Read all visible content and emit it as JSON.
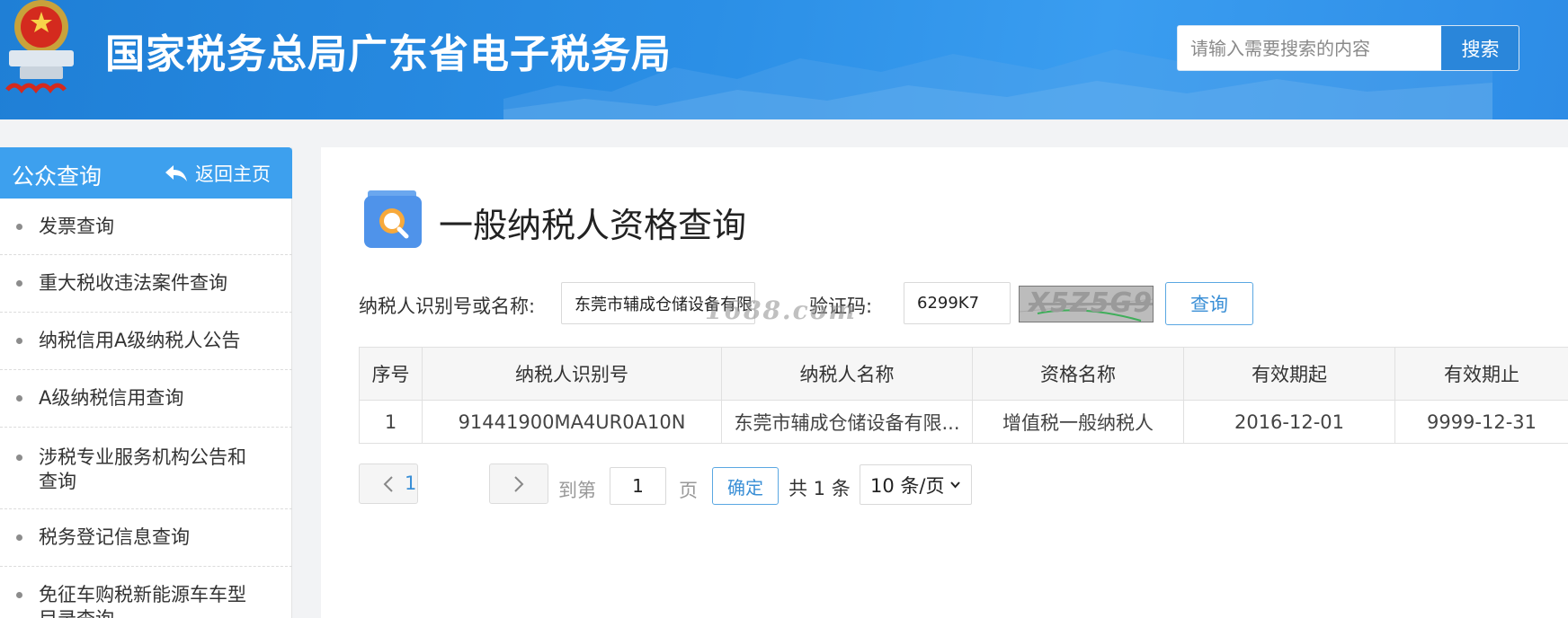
{
  "header": {
    "site_title": "国家税务总局广东省电子税务局",
    "emblem_icon": "national-emblem-icon",
    "search": {
      "placeholder": "请输入需要搜索的内容",
      "value": "",
      "button_label": "搜索"
    },
    "colors": {
      "bg": "#2b8fe6",
      "search_button": "#2a86da"
    }
  },
  "sidebar": {
    "title": "公众查询",
    "back_label": "返回主页",
    "back_icon": "reply-arrow-icon",
    "items": [
      {
        "label": "发票查询"
      },
      {
        "label": "重大税收违法案件查询"
      },
      {
        "label": "纳税信用A级纳税人公告"
      },
      {
        "label": "A级纳税信用查询"
      },
      {
        "label": "涉税专业服务机构公告和查询"
      },
      {
        "label": "税务登记信息查询"
      },
      {
        "label": "免征车购税新能源车车型目录查询"
      }
    ]
  },
  "main": {
    "title": "一般纳税人资格查询",
    "title_icon": "search-document-icon",
    "form": {
      "taxpayer_label": "纳税人识别号或名称:",
      "taxpayer_value": "东莞市辅成仓储设备有限公司",
      "captcha_label": "验证码:",
      "captcha_value": "6299K7",
      "captcha_image_text": "X5Z5G9",
      "query_label": "查询"
    },
    "watermark": "1688.com",
    "table": {
      "headers": [
        "序号",
        "纳税人识别号",
        "纳税人名称",
        "资格名称",
        "有效期起",
        "有效期止"
      ],
      "rows": [
        [
          "1",
          "91441900MA4UR0A10N",
          "东莞市辅成仓储设备有限...",
          "增值税一般纳税人",
          "2016-12-01",
          "9999-12-31"
        ]
      ]
    },
    "pagination": {
      "prev_icon": "chevron-left-icon",
      "next_icon": "chevron-right-icon",
      "current_page": "1",
      "goto_label": "到第",
      "goto_value": "1",
      "page_unit": "页",
      "confirm_label": "确定",
      "total_label": "共 1 条",
      "page_size_selected": "10 条/页"
    }
  }
}
